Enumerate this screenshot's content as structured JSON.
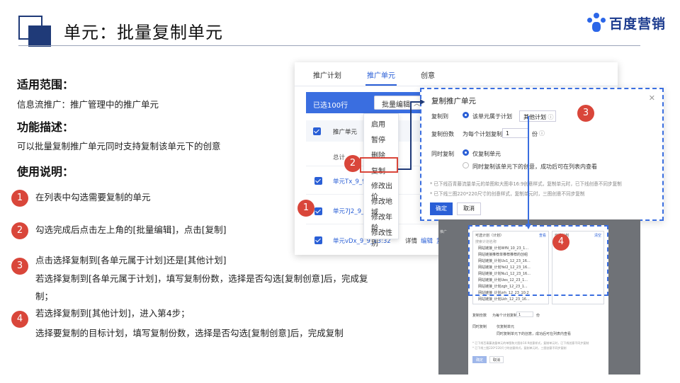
{
  "title": "单元：批量复制单元",
  "brand": {
    "name": "百度营销",
    "accent": "#2b66e8"
  },
  "sections": {
    "scope_heading": "适用范围：",
    "scope_text": "信息流推广：推广管理中的推广单元",
    "feature_heading": "功能描述：",
    "feature_text": "可以批量复制推广单元同时支持复制该单元下的创意",
    "usage_heading": "使用说明："
  },
  "steps": [
    {
      "num": "1",
      "lines": [
        "在列表中勾选需要复制的单元"
      ]
    },
    {
      "num": "2",
      "lines": [
        "勾选完成后点击左上角的[批量编辑]，点击[复制]"
      ]
    },
    {
      "num": "3",
      "lines": [
        "点击选择复制到[各单元属于计划]还是[其他计划]",
        "若选择复制到[各单元属于计划]，填写复制份数，选择是否勾选[复制创意]后，完成复",
        "制；"
      ]
    },
    {
      "num": "4",
      "lines": [
        "若选择复制到[其他计划]，进入第4步；",
        " 选择要复制的目标计划，填写复制份数，选择是否勾选[复制创意]后，完成复制"
      ]
    }
  ],
  "screenshot1": {
    "tabs": [
      "推广计划",
      "推广单元",
      "创意"
    ],
    "selected_text": "已选100行",
    "batch_edit": "批量编辑",
    "column_header": "推广单元",
    "subheader": "总计",
    "rows": [
      "单元Tx_9_9_",
      "单元7J2_9_9_",
      "单元vDx_9_9_13:32"
    ],
    "row_actions": [
      "详情",
      "编辑",
      "复"
    ],
    "menu_items": [
      "启用",
      "暂停",
      "删除",
      "复制",
      "修改出价",
      "修改地域",
      "修改年龄",
      "修改性别"
    ],
    "badges": {
      "step1": "1",
      "step2": "2"
    }
  },
  "dialog": {
    "title": "复制推广单元",
    "copy_to_label": "复制到",
    "option_same_plan": "该单元属于计划",
    "option_other_plan": "其他计划",
    "copies_label": "复制份数",
    "copies_prefix": "为每个计划复制",
    "copies_value": "1",
    "copies_unit": "份",
    "sync_label": "同时复制",
    "sync_option1": "仅复制单元",
    "sync_option2": "同时复制该单元下的创意，成功后可在列表内查看",
    "note1": "* 已下线百青藤流量单元的单图和大图非16:9创意样式，复制单元时，已下线创意不同步复制",
    "note2": "* 已下线三图220*220尺寸的创意样式，复制单元时，三图创意不同步复制",
    "ok": "确定",
    "cancel": "取消",
    "badge": "3"
  },
  "screenshot2": {
    "left_header": "可选计划（计划）",
    "left_link": "查看",
    "right_header": "已选计划",
    "right_link": "清空",
    "search_placeholder": "搜索计划名称",
    "plans": [
      "网站链接_计划WfN_10_23_1...",
      "网站链接推荐单推荐推荐的创组",
      "网站链接_计划Ux1_12_23_16...",
      "网站链接_计划Yel2_12_23_16...",
      "网站链接_计划Nu1_12_23_16...",
      "网站链接_计划Ues_12_23_1...",
      "网站链接_计划zgh_12_23_1...",
      "网站链接_计划zrh_12_23_10:2",
      "网站链接_计划Lkh_12_23_16..."
    ],
    "copies_label": "复制份数",
    "copies_prefix": "为每个计划复制",
    "copies_value": "1",
    "copies_unit": "份",
    "sync_label": "同时复制",
    "sync_option1": "仅复制单元",
    "sync_option2": "同时复制单元下的创意，成功后可在列表内查看",
    "note1": "* 已下线百青藤流量单元的单图和大图非16:9创意样式，复制单元时，已下线创意不同步复制",
    "note2": "* 已下线三图220*220尺寸的创意样式，复制单元时，三图创意不同步复制",
    "ok": "确定",
    "cancel": "取消",
    "badge": "4"
  },
  "colors": {
    "accent_red": "#d9463a",
    "primary_blue": "#2a5fd6",
    "title_navy": "#1f3a78"
  }
}
